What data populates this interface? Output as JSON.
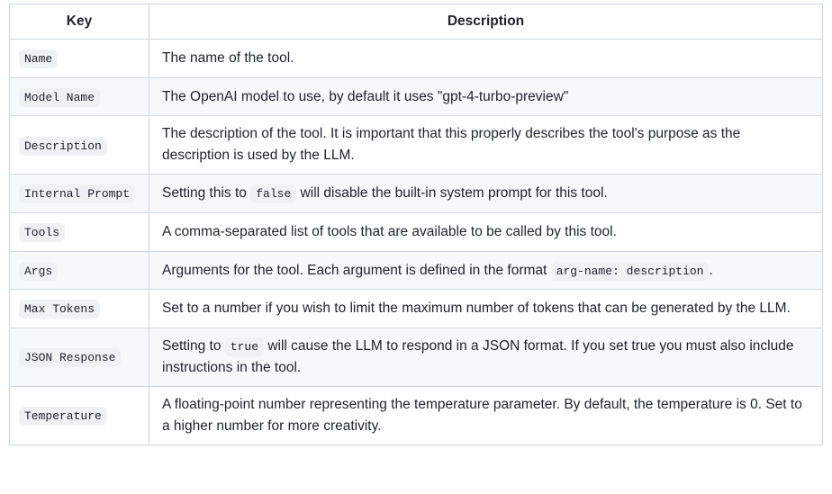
{
  "table": {
    "headers": {
      "key": "Key",
      "description": "Description"
    },
    "rows": [
      {
        "key_code": "Name",
        "desc_pre": "The name of the tool.",
        "desc_code": "",
        "desc_post": ""
      },
      {
        "key_code": "Model Name",
        "desc_pre": "The OpenAI model to use, by default it uses \"gpt-4-turbo-preview\"",
        "desc_code": "",
        "desc_post": ""
      },
      {
        "key_code": "Description",
        "desc_pre": "The description of the tool. It is important that this properly describes the tool's purpose as the description is used by the LLM.",
        "desc_code": "",
        "desc_post": ""
      },
      {
        "key_code": "Internal Prompt",
        "desc_pre": "Setting this to ",
        "desc_code": "false",
        "desc_post": " will disable the built-in system prompt for this tool."
      },
      {
        "key_code": "Tools",
        "desc_pre": "A comma-separated list of tools that are available to be called by this tool.",
        "desc_code": "",
        "desc_post": ""
      },
      {
        "key_code": "Args",
        "desc_pre": "Arguments for the tool. Each argument is defined in the format ",
        "desc_code": "arg-name: description",
        "desc_post": "."
      },
      {
        "key_code": "Max Tokens",
        "desc_pre": "Set to a number if you wish to limit the maximum number of tokens that can be generated by the LLM.",
        "desc_code": "",
        "desc_post": ""
      },
      {
        "key_code": "JSON Response",
        "desc_pre": "Setting to ",
        "desc_code": "true",
        "desc_post": " will cause the LLM to respond in a JSON format. If you set true you must also include instructions in the tool."
      },
      {
        "key_code": "Temperature",
        "desc_pre": "A floating-point number representing the temperature parameter. By default, the temperature is 0. Set to a higher number for more creativity.",
        "desc_code": "",
        "desc_post": ""
      }
    ]
  }
}
